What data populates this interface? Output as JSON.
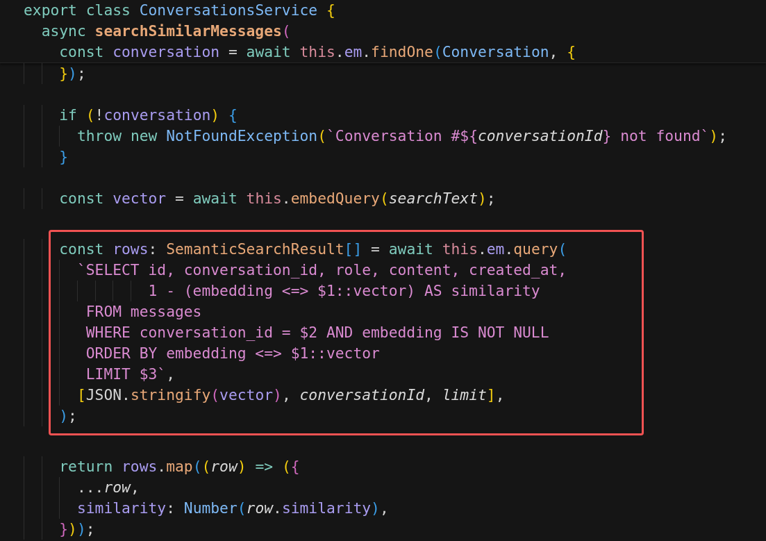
{
  "editor": {
    "sections": [
      {
        "kind": "sticky",
        "lines": [
          {
            "tokens": [
              {
                "t": "export ",
                "kind": "kw"
              },
              {
                "t": "class ",
                "kind": "kw"
              },
              {
                "t": "ConversationsService ",
                "kind": "type"
              },
              {
                "t": "{",
                "kind": "b1"
              }
            ]
          },
          {
            "tokens": [
              {
                "t": "  async ",
                "kind": "kw"
              },
              {
                "t": "searchSimilarMessages",
                "kind": "method"
              },
              {
                "t": "(",
                "kind": "b2"
              }
            ]
          },
          {
            "tokens": [
              {
                "t": "    const ",
                "kind": "kw"
              },
              {
                "t": "conversation",
                "kind": "var"
              },
              {
                "t": " = ",
                "kind": "plain"
              },
              {
                "t": "await ",
                "kind": "kw"
              },
              {
                "t": "this",
                "kind": "this"
              },
              {
                "t": ".",
                "kind": "plain"
              },
              {
                "t": "em",
                "kind": "var"
              },
              {
                "t": ".",
                "kind": "plain"
              },
              {
                "t": "findOne",
                "kind": "func"
              },
              {
                "t": "(",
                "kind": "b3"
              },
              {
                "t": "Conversation",
                "kind": "type"
              },
              {
                "t": ", ",
                "kind": "plain"
              },
              {
                "t": "{",
                "kind": "b1"
              }
            ]
          }
        ]
      },
      {
        "kind": "plain",
        "lines": [
          {
            "tokens": [
              {
                "t": "    }",
                "kind": "b1"
              },
              {
                "t": ")",
                "kind": "b3"
              },
              {
                "t": ";",
                "kind": "plain"
              }
            ]
          }
        ]
      },
      {
        "kind": "plain",
        "lines": [
          {
            "tokens": [
              {
                "t": "    if ",
                "kind": "kw"
              },
              {
                "t": "(",
                "kind": "b1"
              },
              {
                "t": "!",
                "kind": "plain"
              },
              {
                "t": "conversation",
                "kind": "var"
              },
              {
                "t": ") ",
                "kind": "b1"
              },
              {
                "t": "{",
                "kind": "b3"
              }
            ]
          },
          {
            "tokens": [
              {
                "t": "      throw ",
                "kind": "kw"
              },
              {
                "t": "new ",
                "kind": "kw"
              },
              {
                "t": "NotFoundException",
                "kind": "type"
              },
              {
                "t": "(",
                "kind": "b1"
              },
              {
                "t": "`Conversation #${",
                "kind": "str"
              },
              {
                "t": "conversationId",
                "kind": "param"
              },
              {
                "t": "} not found`",
                "kind": "str"
              },
              {
                "t": ")",
                "kind": "b1"
              },
              {
                "t": ";",
                "kind": "plain"
              }
            ]
          },
          {
            "tokens": [
              {
                "t": "    }",
                "kind": "b3"
              }
            ]
          }
        ]
      },
      {
        "kind": "plain",
        "lines": [
          {
            "tokens": [
              {
                "t": "    const ",
                "kind": "kw"
              },
              {
                "t": "vector",
                "kind": "var"
              },
              {
                "t": " = ",
                "kind": "plain"
              },
              {
                "t": "await ",
                "kind": "kw"
              },
              {
                "t": "this",
                "kind": "this"
              },
              {
                "t": ".",
                "kind": "plain"
              },
              {
                "t": "embedQuery",
                "kind": "func"
              },
              {
                "t": "(",
                "kind": "b1"
              },
              {
                "t": "searchText",
                "kind": "param"
              },
              {
                "t": ")",
                "kind": "b1"
              },
              {
                "t": ";",
                "kind": "plain"
              }
            ]
          }
        ]
      },
      {
        "kind": "highlighted",
        "lines": [
          {
            "tokens": [
              {
                "t": "    const ",
                "kind": "kw"
              },
              {
                "t": "rows",
                "kind": "var"
              },
              {
                "t": ": ",
                "kind": "plain"
              },
              {
                "t": "SemanticSearchResult",
                "kind": "func"
              },
              {
                "t": "[]",
                "kind": "b3"
              },
              {
                "t": " = ",
                "kind": "plain"
              },
              {
                "t": "await ",
                "kind": "kw"
              },
              {
                "t": "this",
                "kind": "this"
              },
              {
                "t": ".",
                "kind": "plain"
              },
              {
                "t": "em",
                "kind": "var"
              },
              {
                "t": ".",
                "kind": "plain"
              },
              {
                "t": "query",
                "kind": "func"
              },
              {
                "t": "(",
                "kind": "b3"
              }
            ]
          },
          {
            "tokens": [
              {
                "t": "      `SELECT id, conversation_id, role, content, created_at,",
                "kind": "str"
              }
            ]
          },
          {
            "tokens": [
              {
                "t": "              1 - (embedding <=> $1::vector) AS similarity",
                "kind": "str"
              }
            ]
          },
          {
            "tokens": [
              {
                "t": "       FROM messages",
                "kind": "str"
              }
            ]
          },
          {
            "tokens": [
              {
                "t": "       WHERE conversation_id = $2 AND embedding IS NOT NULL",
                "kind": "str"
              }
            ]
          },
          {
            "tokens": [
              {
                "t": "       ORDER BY embedding <=> $1::vector",
                "kind": "str"
              }
            ]
          },
          {
            "tokens": [
              {
                "t": "       LIMIT $3`",
                "kind": "str"
              },
              {
                "t": ",",
                "kind": "plain"
              }
            ]
          },
          {
            "tokens": [
              {
                "t": "      [",
                "kind": "b1"
              },
              {
                "t": "JSON.",
                "kind": "plain"
              },
              {
                "t": "stringify",
                "kind": "func"
              },
              {
                "t": "(",
                "kind": "b2"
              },
              {
                "t": "vector",
                "kind": "var"
              },
              {
                "t": ")",
                "kind": "b2"
              },
              {
                "t": ", ",
                "kind": "plain"
              },
              {
                "t": "conversationId",
                "kind": "param"
              },
              {
                "t": ", ",
                "kind": "plain"
              },
              {
                "t": "limit",
                "kind": "param"
              },
              {
                "t": "]",
                "kind": "b1"
              },
              {
                "t": ",",
                "kind": "plain"
              }
            ]
          },
          {
            "tokens": [
              {
                "t": "    )",
                "kind": "b3"
              },
              {
                "t": ";",
                "kind": "plain"
              }
            ]
          }
        ]
      },
      {
        "kind": "plain",
        "lines": [
          {
            "tokens": [
              {
                "t": "    return ",
                "kind": "kw"
              },
              {
                "t": "rows",
                "kind": "var"
              },
              {
                "t": ".",
                "kind": "plain"
              },
              {
                "t": "map",
                "kind": "func"
              },
              {
                "t": "(",
                "kind": "b3"
              },
              {
                "t": "(",
                "kind": "b1"
              },
              {
                "t": "row",
                "kind": "param"
              },
              {
                "t": ") ",
                "kind": "b1"
              },
              {
                "t": "=> ",
                "kind": "kw"
              },
              {
                "t": "(",
                "kind": "b1"
              },
              {
                "t": "{",
                "kind": "b2"
              }
            ]
          },
          {
            "tokens": [
              {
                "t": "      ...",
                "kind": "plain"
              },
              {
                "t": "row",
                "kind": "param"
              },
              {
                "t": ",",
                "kind": "plain"
              }
            ]
          },
          {
            "tokens": [
              {
                "t": "      similarity",
                "kind": "var"
              },
              {
                "t": ": ",
                "kind": "plain"
              },
              {
                "t": "Number",
                "kind": "type"
              },
              {
                "t": "(",
                "kind": "b3"
              },
              {
                "t": "row",
                "kind": "param"
              },
              {
                "t": ".",
                "kind": "plain"
              },
              {
                "t": "similarity",
                "kind": "var"
              },
              {
                "t": ")",
                "kind": "b3"
              },
              {
                "t": ",",
                "kind": "plain"
              }
            ]
          },
          {
            "tokens": [
              {
                "t": "    }",
                "kind": "b2"
              },
              {
                "t": ")",
                "kind": "b1"
              },
              {
                "t": ")",
                "kind": "b3"
              },
              {
                "t": ";",
                "kind": "plain"
              }
            ]
          }
        ]
      }
    ]
  }
}
